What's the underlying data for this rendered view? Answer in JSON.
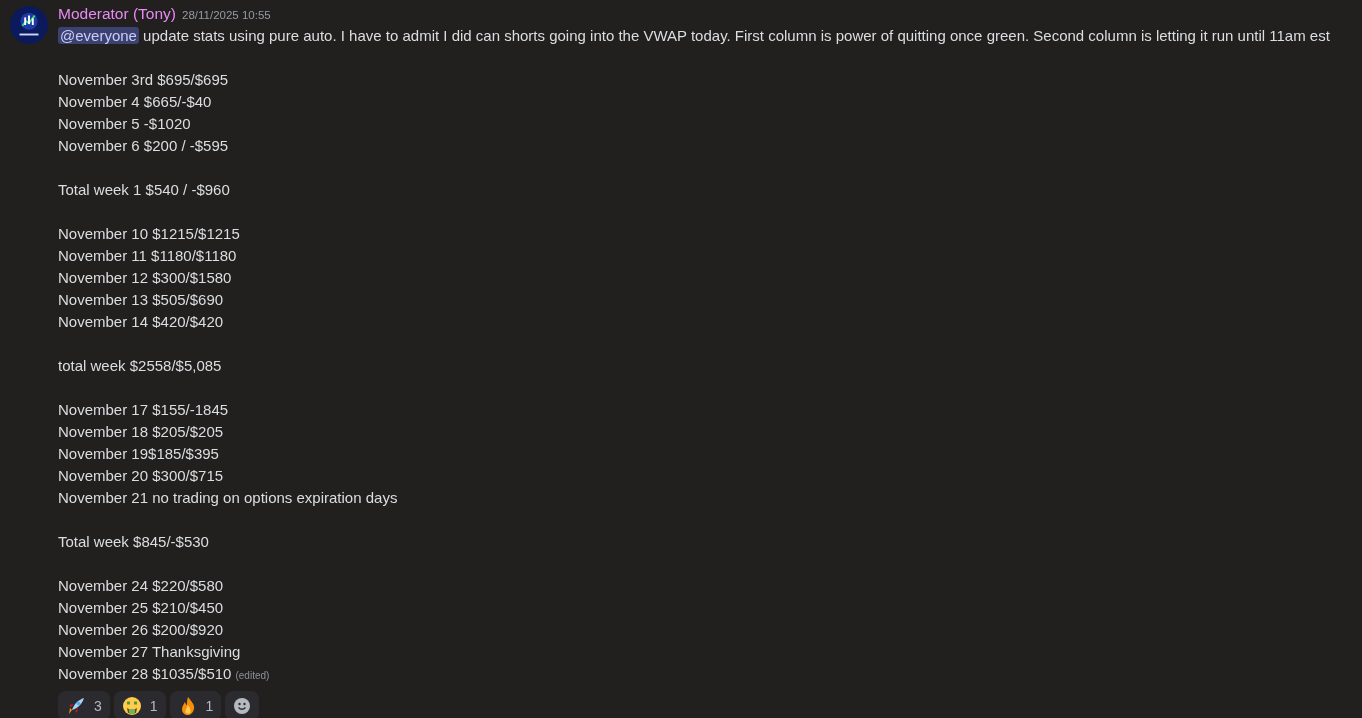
{
  "message": {
    "author": "Moderator (Tony)",
    "timestamp": "28/11/2025 10:55",
    "mention": "@everyone",
    "intro": "update stats using pure auto. I have to admit I did can shorts going into the VWAP today. First column is power of quitting once green. Second column is letting it run until 11am est",
    "blocks": [
      [
        "November 3rd $695/$695",
        "November 4 $665/-$40",
        "November 5 -$1020",
        "November 6 $200 / -$595"
      ],
      [
        "Total week 1 $540 / -$960"
      ],
      [
        "November 10 $1215/$1215",
        "November 11 $1180/$1180",
        "November 12 $300/$1580",
        "November 13 $505/$690",
        "November 14 $420/$420"
      ],
      [
        "total week $2558/$5,085"
      ],
      [
        "November 17 $155/-1845",
        "November 18 $205/$205",
        "November 19$185/$395",
        "November 20 $300/$715",
        "November 21 no trading on options expiration days"
      ],
      [
        "Total week $845/-$530"
      ],
      [
        "November 24 $220/$580",
        "November 25 $210/$450",
        "November 26 $200/$920",
        "November 27 Thanksgiving",
        "November 28 $1035/$510"
      ]
    ],
    "edited_label": "(edited)",
    "reactions": [
      {
        "kind": "rocket",
        "count": "3"
      },
      {
        "kind": "money-face",
        "count": "1"
      },
      {
        "kind": "fire",
        "count": "1"
      }
    ]
  }
}
